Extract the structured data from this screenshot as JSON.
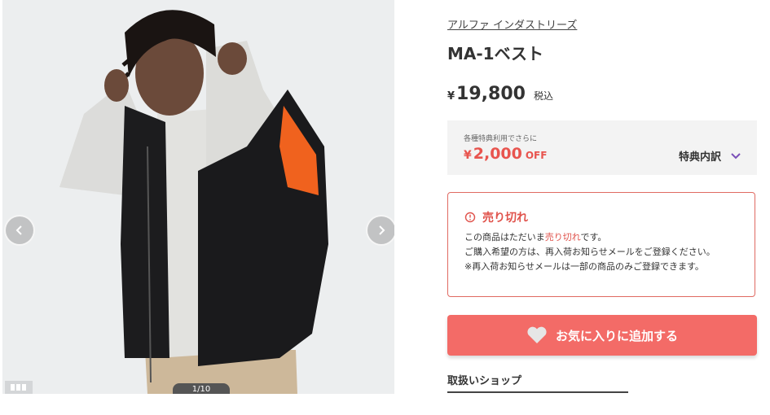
{
  "product": {
    "brand": "アルファ インダストリーズ",
    "name": "MA-1ベスト",
    "price_prefix": "¥",
    "price": "19,800",
    "tax_label": "税込"
  },
  "gallery": {
    "counter": "1/10"
  },
  "coupon": {
    "caption": "各種特典利用でさらに",
    "yen": "¥",
    "amount": "2,000",
    "off_label": "OFF",
    "detail_label": "特典内訳"
  },
  "soldout": {
    "title": "売り切れ",
    "line1_before": "この商品はただいま",
    "line1_highlight": "売り切れ",
    "line1_after": "です。",
    "line2": "ご購入希望の方は、再入荷お知らせメールをご登録ください。",
    "line3": "※再入荷お知らせメールは一部の商品のみご登録できます。"
  },
  "favorite_button": {
    "label": "お気に入りに追加する"
  },
  "shop": {
    "label": "取扱いショップ"
  },
  "colors": {
    "accent_red": "#e0534c",
    "button_red": "#f36b67",
    "chevron_purple": "#7a4fb8"
  }
}
